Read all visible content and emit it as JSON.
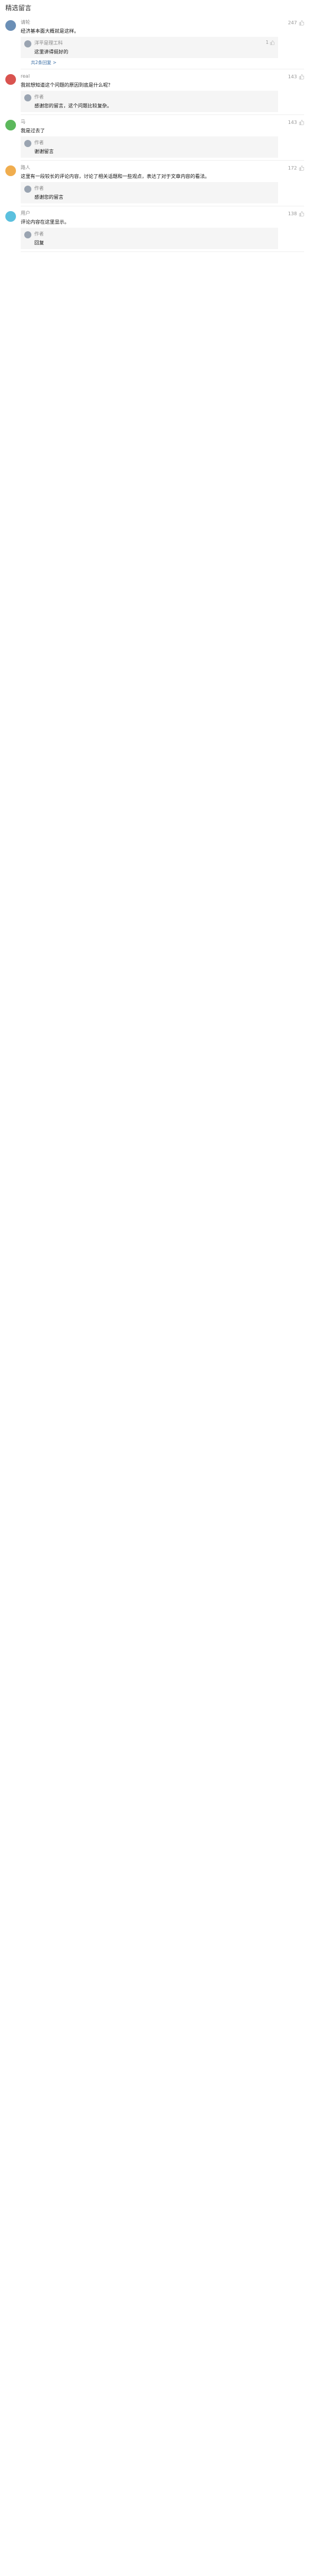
{
  "header": {
    "title": "精选留言"
  },
  "colors": {
    "like_icon": "#bbbbbb",
    "more_link": "#3a6ea5"
  },
  "comments": [
    {
      "name": "请轮",
      "text": "经济基本面大概就是这样。",
      "time": "",
      "likes": "247",
      "replies": [
        {
          "name": "洋平是理工科",
          "text": "这里讲得挺好的",
          "likes": "1",
          "time": ""
        }
      ],
      "more": "共2条回复 >",
      "avatar": "#6b8fb6"
    },
    {
      "name": "real",
      "text": "我就想知道这个问题的原因到底是什么呢？",
      "time": "",
      "likes": "143",
      "replies": [
        {
          "name": "作者",
          "text": "感谢您的留言，这个问题比较复杂。",
          "likes": "",
          "time": ""
        }
      ],
      "more": "",
      "avatar": "#d9534f"
    },
    {
      "name": "马",
      "text": "我是过去了",
      "time": "",
      "likes": "143",
      "replies": [
        {
          "name": "作者",
          "text": "谢谢留言",
          "likes": "",
          "time": ""
        }
      ],
      "more": "",
      "avatar": "#5cb85c"
    },
    {
      "name": "路人",
      "text": "这里有一段较长的评论内容，讨论了相关话题和一些观点，表达了对于文章内容的看法。",
      "time": "",
      "likes": "172",
      "replies": [
        {
          "name": "作者",
          "text": "感谢您的留言",
          "likes": "",
          "time": ""
        }
      ],
      "more": "",
      "avatar": "#f0ad4e"
    },
    {
      "name": "用户",
      "text": "评论内容在这里显示。",
      "time": "",
      "likes": "138",
      "replies": [
        {
          "name": "作者",
          "text": "回复",
          "likes": "",
          "time": ""
        }
      ],
      "more": "",
      "avatar": "#5bc0de"
    }
  ]
}
